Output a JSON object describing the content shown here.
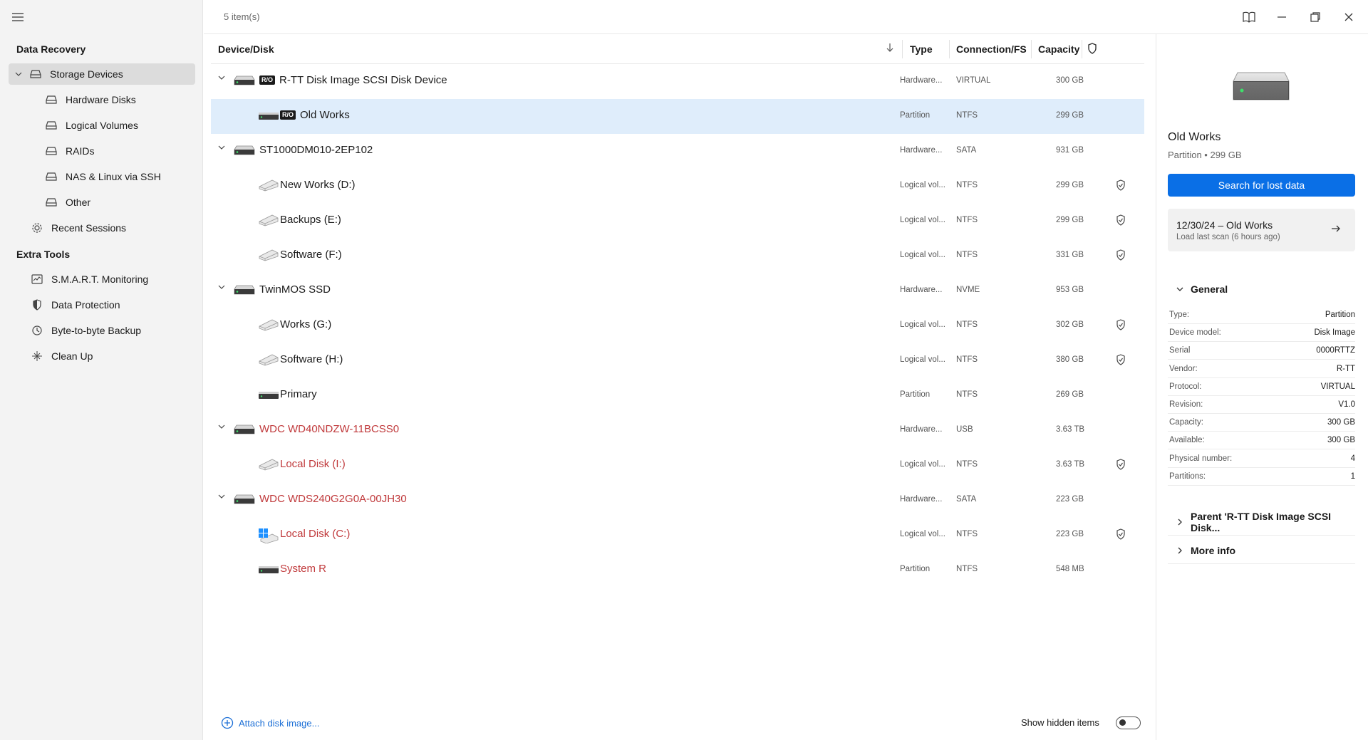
{
  "sidebar": {
    "section_recovery": "Data Recovery",
    "section_tools": "Extra Tools",
    "items": [
      {
        "label": "Storage Devices",
        "icon": "disk-icon"
      },
      {
        "label": "Hardware Disks",
        "icon": "disk-icon"
      },
      {
        "label": "Logical Volumes",
        "icon": "disk-icon"
      },
      {
        "label": "RAIDs",
        "icon": "disk-icon"
      },
      {
        "label": "NAS & Linux via SSH",
        "icon": "disk-icon"
      },
      {
        "label": "Other",
        "icon": "disk-icon"
      },
      {
        "label": "Recent Sessions",
        "icon": "gear-icon"
      }
    ],
    "tools": [
      {
        "label": "S.M.A.R.T. Monitoring",
        "icon": "monitor-chart-icon"
      },
      {
        "label": "Data Protection",
        "icon": "half-shield-icon"
      },
      {
        "label": "Byte-to-byte Backup",
        "icon": "history-clock-icon"
      },
      {
        "label": "Clean Up",
        "icon": "sparkle-icon"
      }
    ]
  },
  "topbar": {
    "item_count": "5 item(s)"
  },
  "table": {
    "headers": {
      "device": "Device/Disk",
      "type": "Type",
      "connection": "Connection/FS",
      "capacity": "Capacity"
    },
    "rows": [
      {
        "name": "R-TT Disk Image SCSI Disk Device",
        "ro": "R/O",
        "type": "Hardware...",
        "conn": "VIRTUAL",
        "cap": "300 GB",
        "level": 0,
        "red": false,
        "protected": false,
        "icon": "hdd"
      },
      {
        "name": "Old Works",
        "ro": "R/O",
        "type": "Partition",
        "conn": "NTFS",
        "cap": "299 GB",
        "level": 1,
        "red": false,
        "protected": false,
        "icon": "partition",
        "selected": true
      },
      {
        "name": "ST1000DM010-2EP102",
        "type": "Hardware...",
        "conn": "SATA",
        "cap": "931 GB",
        "level": 0,
        "red": false,
        "protected": false,
        "icon": "hdd"
      },
      {
        "name": "New Works (D:)",
        "type": "Logical vol...",
        "conn": "NTFS",
        "cap": "299 GB",
        "level": 1,
        "red": false,
        "protected": true,
        "icon": "volume"
      },
      {
        "name": "Backups (E:)",
        "type": "Logical vol...",
        "conn": "NTFS",
        "cap": "299 GB",
        "level": 1,
        "red": false,
        "protected": true,
        "icon": "volume"
      },
      {
        "name": "Software (F:)",
        "type": "Logical vol...",
        "conn": "NTFS",
        "cap": "331 GB",
        "level": 1,
        "red": false,
        "protected": true,
        "icon": "volume"
      },
      {
        "name": "TwinMOS SSD",
        "type": "Hardware...",
        "conn": "NVME",
        "cap": "953 GB",
        "level": 0,
        "red": false,
        "protected": false,
        "icon": "hdd"
      },
      {
        "name": "Works (G:)",
        "type": "Logical vol...",
        "conn": "NTFS",
        "cap": "302 GB",
        "level": 1,
        "red": false,
        "protected": true,
        "icon": "volume"
      },
      {
        "name": "Software (H:)",
        "type": "Logical vol...",
        "conn": "NTFS",
        "cap": "380 GB",
        "level": 1,
        "red": false,
        "protected": true,
        "icon": "volume"
      },
      {
        "name": "Primary",
        "type": "Partition",
        "conn": "NTFS",
        "cap": "269 GB",
        "level": 1,
        "red": false,
        "protected": false,
        "icon": "partition"
      },
      {
        "name": "WDC WD40NDZW-11BCSS0",
        "type": "Hardware...",
        "conn": "USB",
        "cap": "3.63 TB",
        "level": 0,
        "red": true,
        "protected": false,
        "icon": "hdd"
      },
      {
        "name": "Local Disk (I:)",
        "type": "Logical vol...",
        "conn": "NTFS",
        "cap": "3.63 TB",
        "level": 1,
        "red": true,
        "protected": true,
        "icon": "volume"
      },
      {
        "name": "WDC WDS240G2G0A-00JH30",
        "type": "Hardware...",
        "conn": "SATA",
        "cap": "223 GB",
        "level": 0,
        "red": true,
        "protected": false,
        "icon": "hdd"
      },
      {
        "name": "Local Disk (C:)",
        "type": "Logical vol...",
        "conn": "NTFS",
        "cap": "223 GB",
        "level": 1,
        "red": true,
        "protected": true,
        "icon": "windows-volume"
      },
      {
        "name": "System R",
        "type": "Partition",
        "conn": "NTFS",
        "cap": "548 MB",
        "level": 1,
        "red": true,
        "protected": false,
        "icon": "partition"
      }
    ]
  },
  "bottom": {
    "attach": "Attach disk image...",
    "show_hidden": "Show hidden items",
    "show_hidden_on": false
  },
  "detail": {
    "title": "Old Works",
    "subtitle": "Partition • 299 GB",
    "search_button": "Search for lost data",
    "session_title": "12/30/24 – Old Works",
    "session_sub": "Load last scan (6 hours ago)",
    "general": "General",
    "props": [
      {
        "k": "Type:",
        "v": "Partition"
      },
      {
        "k": "Device model:",
        "v": "Disk Image"
      },
      {
        "k": "Serial",
        "v": "0000RTTZ"
      },
      {
        "k": "Vendor:",
        "v": "R-TT"
      },
      {
        "k": "Protocol:",
        "v": "VIRTUAL"
      },
      {
        "k": "Revision:",
        "v": "V1.0"
      },
      {
        "k": "Capacity:",
        "v": "300 GB"
      },
      {
        "k": "Available:",
        "v": "300 GB"
      },
      {
        "k": "Physical number:",
        "v": "4"
      },
      {
        "k": "Partitions:",
        "v": "1"
      }
    ],
    "parent": "Parent 'R-TT Disk Image SCSI Disk...",
    "more_info": "More info"
  },
  "colors": {
    "accent": "#0a6fe6",
    "selected_row": "#dfedfb",
    "warning_text": "#c0393b"
  }
}
